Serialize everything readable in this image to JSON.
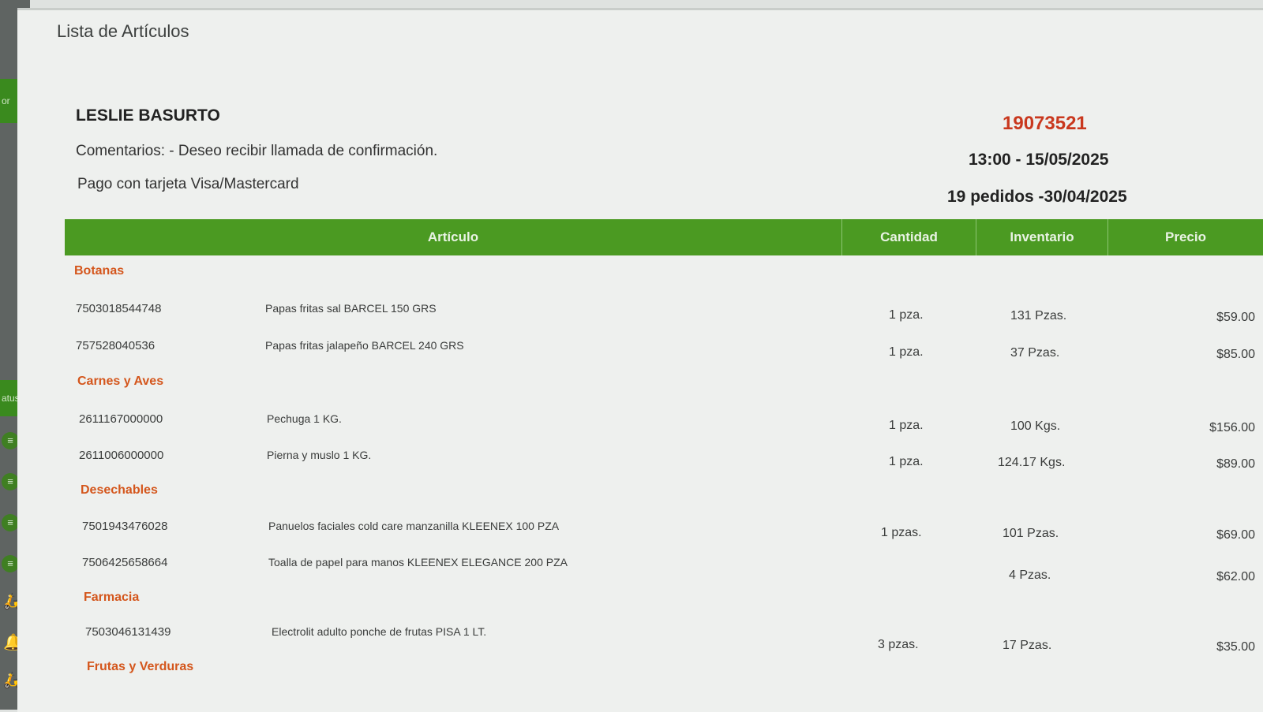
{
  "sidebar": {
    "tab_top": "or",
    "tab_status": "atus"
  },
  "page": {
    "title": "Lista de Artículos"
  },
  "order": {
    "customer_name": "LESLIE BASURTO",
    "comments": "Comentarios:  - Deseo recibir llamada de confirmación.",
    "payment": "Pago con tarjeta Visa/Mastercard",
    "order_number": "19073521",
    "delivery": "13:00 - 15/05/2025",
    "orders_count": "19 pedidos -30/04/2025"
  },
  "table": {
    "headers": {
      "articulo": "Artículo",
      "cantidad": "Cantidad",
      "inventario": "Inventario",
      "precio": "Precio"
    },
    "categories": [
      {
        "name": "Botanas",
        "items": [
          {
            "code": "7503018544748",
            "name": "Papas fritas sal BARCEL 150 GRS",
            "qty": "1 pza.",
            "inventory": "131 Pzas.",
            "price": "$59.00"
          },
          {
            "code": "757528040536",
            "name": "Papas fritas jalapeño BARCEL 240 GRS",
            "qty": "1 pza.",
            "inventory": "37 Pzas.",
            "price": "$85.00"
          }
        ]
      },
      {
        "name": "Carnes y Aves",
        "items": [
          {
            "code": "2611167000000",
            "name": "Pechuga 1 KG.",
            "qty": "1 pza.",
            "inventory": "100 Kgs.",
            "price": "$156.00"
          },
          {
            "code": "2611006000000",
            "name": "Pierna y muslo 1 KG.",
            "qty": "1 pza.",
            "inventory": "124.17 Kgs.",
            "price": "$89.00"
          }
        ]
      },
      {
        "name": "Desechables",
        "items": [
          {
            "code": "7501943476028",
            "name": "Panuelos faciales cold care manzanilla KLEENEX 100 PZA",
            "qty": "1 pzas.",
            "inventory": "101 Pzas.",
            "price": "$69.00"
          },
          {
            "code": "7506425658664",
            "name": "Toalla de papel para manos KLEENEX ELEGANCE 200 PZA",
            "qty": "",
            "inventory": "4 Pzas.",
            "price": "$62.00"
          }
        ]
      },
      {
        "name": "Farmacia",
        "items": [
          {
            "code": "7503046131439",
            "name": "Electrolit adulto ponche de frutas PISA 1 LT.",
            "qty": "3 pzas.",
            "inventory": "17 Pzas.",
            "price": "$35.00"
          }
        ]
      },
      {
        "name": "Frutas y Verduras",
        "items": []
      }
    ]
  }
}
